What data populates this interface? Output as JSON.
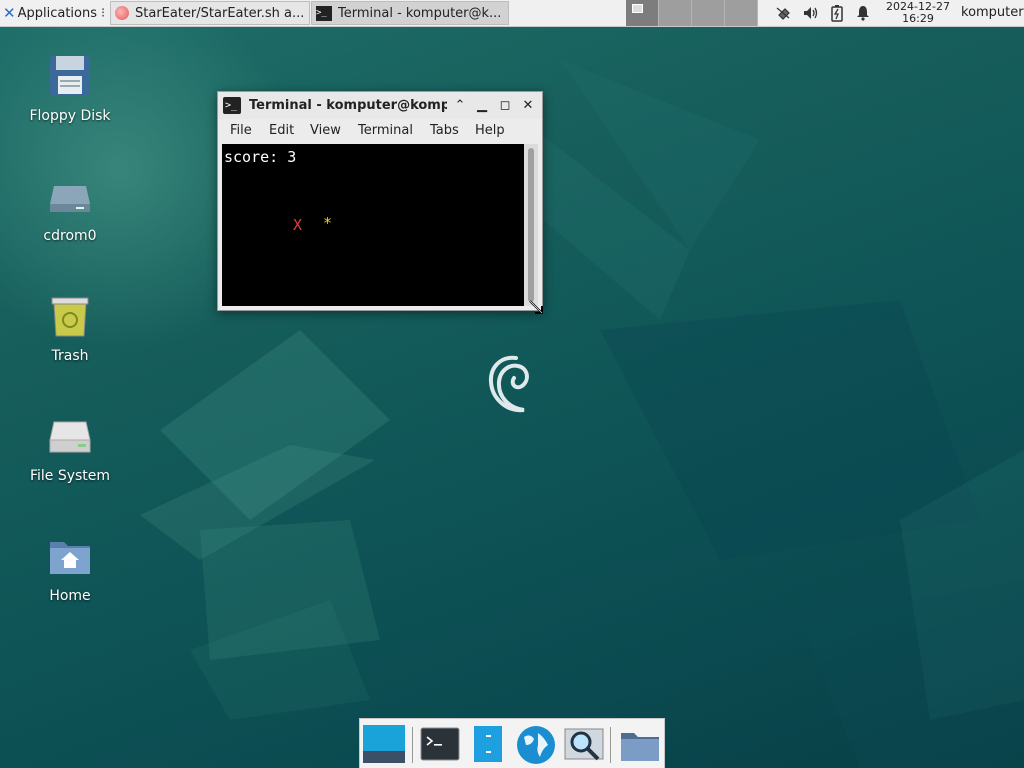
{
  "top_panel": {
    "applications_label": "Applications",
    "tasks": [
      {
        "label": "StarEater/StarEater.sh a..."
      },
      {
        "label": "Terminal - komputer@k..."
      }
    ],
    "clock_date": "2024-12-27",
    "clock_time": "16:29",
    "user": "komputer"
  },
  "desktop_icons": [
    {
      "label": "Floppy Disk",
      "icon": "floppy-icon"
    },
    {
      "label": "cdrom0",
      "icon": "drive-icon"
    },
    {
      "label": "Trash",
      "icon": "trash-icon"
    },
    {
      "label": "File System",
      "icon": "filesystem-icon"
    },
    {
      "label": "Home",
      "icon": "home-folder-icon"
    }
  ],
  "terminal": {
    "title": "Terminal - komputer@kompu",
    "menu": [
      "File",
      "Edit",
      "View",
      "Terminal",
      "Tabs",
      "Help"
    ],
    "score_line": "score: 3",
    "player_char": "X",
    "star_char": "*"
  },
  "dock": {
    "items": [
      "show-desktop-icon",
      "terminal-icon",
      "file-manager-icon",
      "web-browser-icon",
      "app-finder-icon",
      "folder-icon"
    ]
  },
  "colors": {
    "wallpaper": "#175f5c",
    "player": "#e04040",
    "star": "#f0d030"
  }
}
